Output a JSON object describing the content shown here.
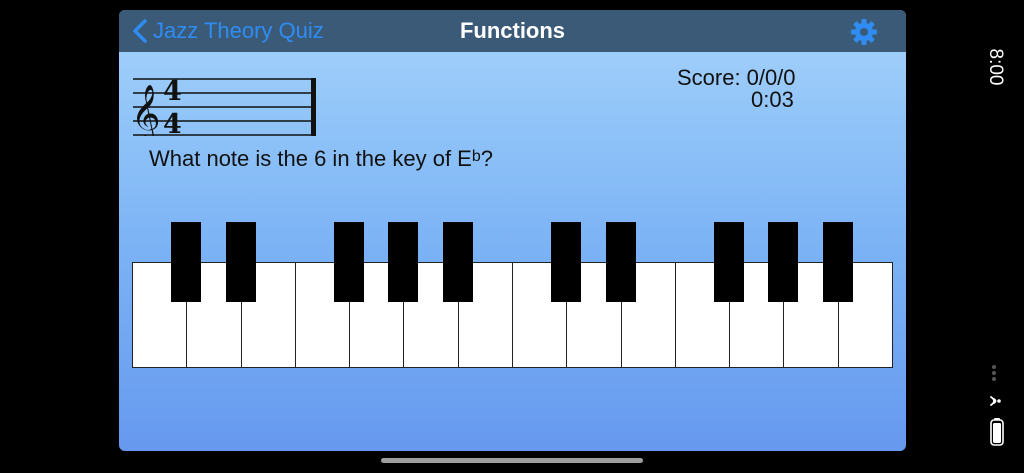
{
  "status_bar": {
    "time": "8:00"
  },
  "navbar": {
    "back_label": "Jazz Theory Quiz",
    "title": "Functions",
    "back_icon": "chevron-left-icon",
    "settings_icon": "gear-icon",
    "accent_color": "#2f8cf2",
    "bar_color": "#3b5a78"
  },
  "staff": {
    "clef": "treble",
    "time_signature_top": "4",
    "time_signature_bottom": "4"
  },
  "score": {
    "label": "Score:",
    "value": "0/0/0",
    "timer": "0:03"
  },
  "question": {
    "prefix": "What note is the 6 in the key of E",
    "flat": "b",
    "suffix": "?"
  },
  "piano": {
    "white_keys": 14,
    "black_keys": 10
  }
}
